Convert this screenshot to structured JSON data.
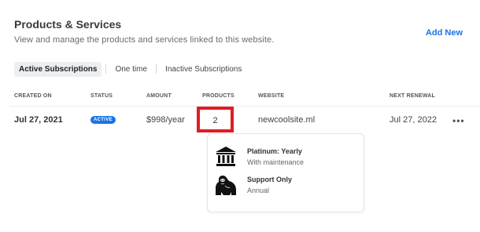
{
  "header": {
    "title": "Products & Services",
    "subtitle": "View and manage the products and services linked to this website.",
    "add_new_label": "Add New"
  },
  "tabs": [
    {
      "label": "Active Subscriptions",
      "active": true
    },
    {
      "label": "One time",
      "active": false
    },
    {
      "label": "Inactive Subscriptions",
      "active": false
    }
  ],
  "table": {
    "columns": [
      "CREATED ON",
      "STATUS",
      "AMOUNT",
      "PRODUCTS",
      "WEBSITE",
      "NEXT RENEWAL"
    ],
    "row": {
      "created_on": "Jul 27, 2021",
      "status": "ACTIVE",
      "amount": "$998/year",
      "products": "2",
      "website": "newcoolsite.ml",
      "next_renewal": "Jul 27, 2022",
      "more_label": "•••"
    }
  },
  "products_popover": {
    "items": [
      {
        "title": "Platinum: Yearly",
        "subtitle": "With maintenance",
        "icon": "bank-icon"
      },
      {
        "title": "Support Only",
        "subtitle": "Annual",
        "icon": "gorilla-icon"
      }
    ]
  },
  "colors": {
    "accent": "#1a73e8",
    "highlight": "#e11b22",
    "active_tab_bg": "#eceef1"
  }
}
